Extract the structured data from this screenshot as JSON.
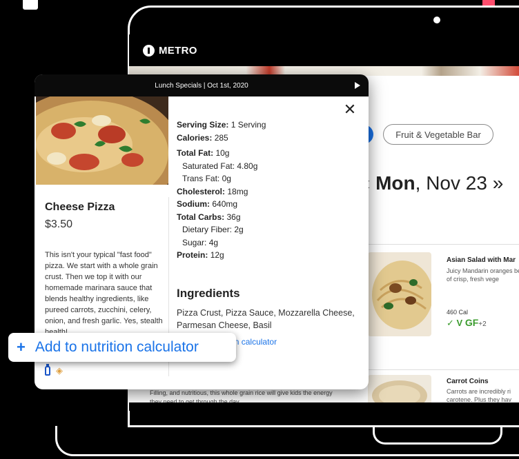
{
  "app": {
    "logo_text": "METRO"
  },
  "screen": {
    "filter_pill": "Fruit & Vegetable Bar",
    "date": {
      "prev": "‹",
      "day": "Mon",
      "rest": ", Nov 23",
      "next": "»"
    },
    "cards": [
      {
        "title": "Asian Salad with Mar",
        "desc": "Juicy Mandarin oranges bed of crisp, fresh vege",
        "calories": "460 Cal",
        "diet_more": "+2"
      },
      {
        "title": "Carrot Coins",
        "desc": "Carrots are incredibly ri carotene. Plus they hav"
      }
    ],
    "lower_desc": "Filling, and nutritious, this whole grain rice will give kids the energy they need to get through the day."
  },
  "modal": {
    "video_title": "Lunch Specials | Oct 1st, 2020",
    "close": "✕",
    "item": {
      "name": "Cheese Pizza",
      "price": "$3.50",
      "description": "This isn't your typical \"fast food\" pizza. We start with a whole grain crust. Then we top it with our homemade marinara sauce that blends healthy ingredients, like pureed carrots, zucchini, celery, onion, and fresh garlic. Yes, stealth health!"
    },
    "nutrition": {
      "serving_size_label": "Serving Size:",
      "serving_size": "1 Serving",
      "calories_label": "Calories:",
      "calories": "285",
      "total_fat_label": "Total Fat:",
      "total_fat": "10g",
      "saturated_fat": "Saturated Fat: 4.80g",
      "trans_fat": "Trans Fat: 0g",
      "cholesterol_label": "Cholesterol:",
      "cholesterol": "18mg",
      "sodium_label": "Sodium:",
      "sodium": "640mg",
      "total_carbs_label": "Total Carbs:",
      "total_carbs": "36g",
      "dietary_fiber": "Dietary Fiber: 2g",
      "sugar": "Sugar: 4g",
      "protein_label": "Protein:",
      "protein": "12g"
    },
    "ingredients_heading": "Ingredients",
    "ingredients": "Pizza Crust, Pizza Sauce, Mozzarella Cheese, Parmesan Cheese, Basil",
    "add_link_visible": "ition calculator",
    "badges": [
      "bottle-icon",
      "wheat-icon"
    ]
  },
  "callout": {
    "icon": "+",
    "label": "Add to nutrition calculator"
  },
  "colors": {
    "accent": "#1a73e8",
    "green": "#3a9b2d",
    "alert": "#ff4d6d"
  }
}
